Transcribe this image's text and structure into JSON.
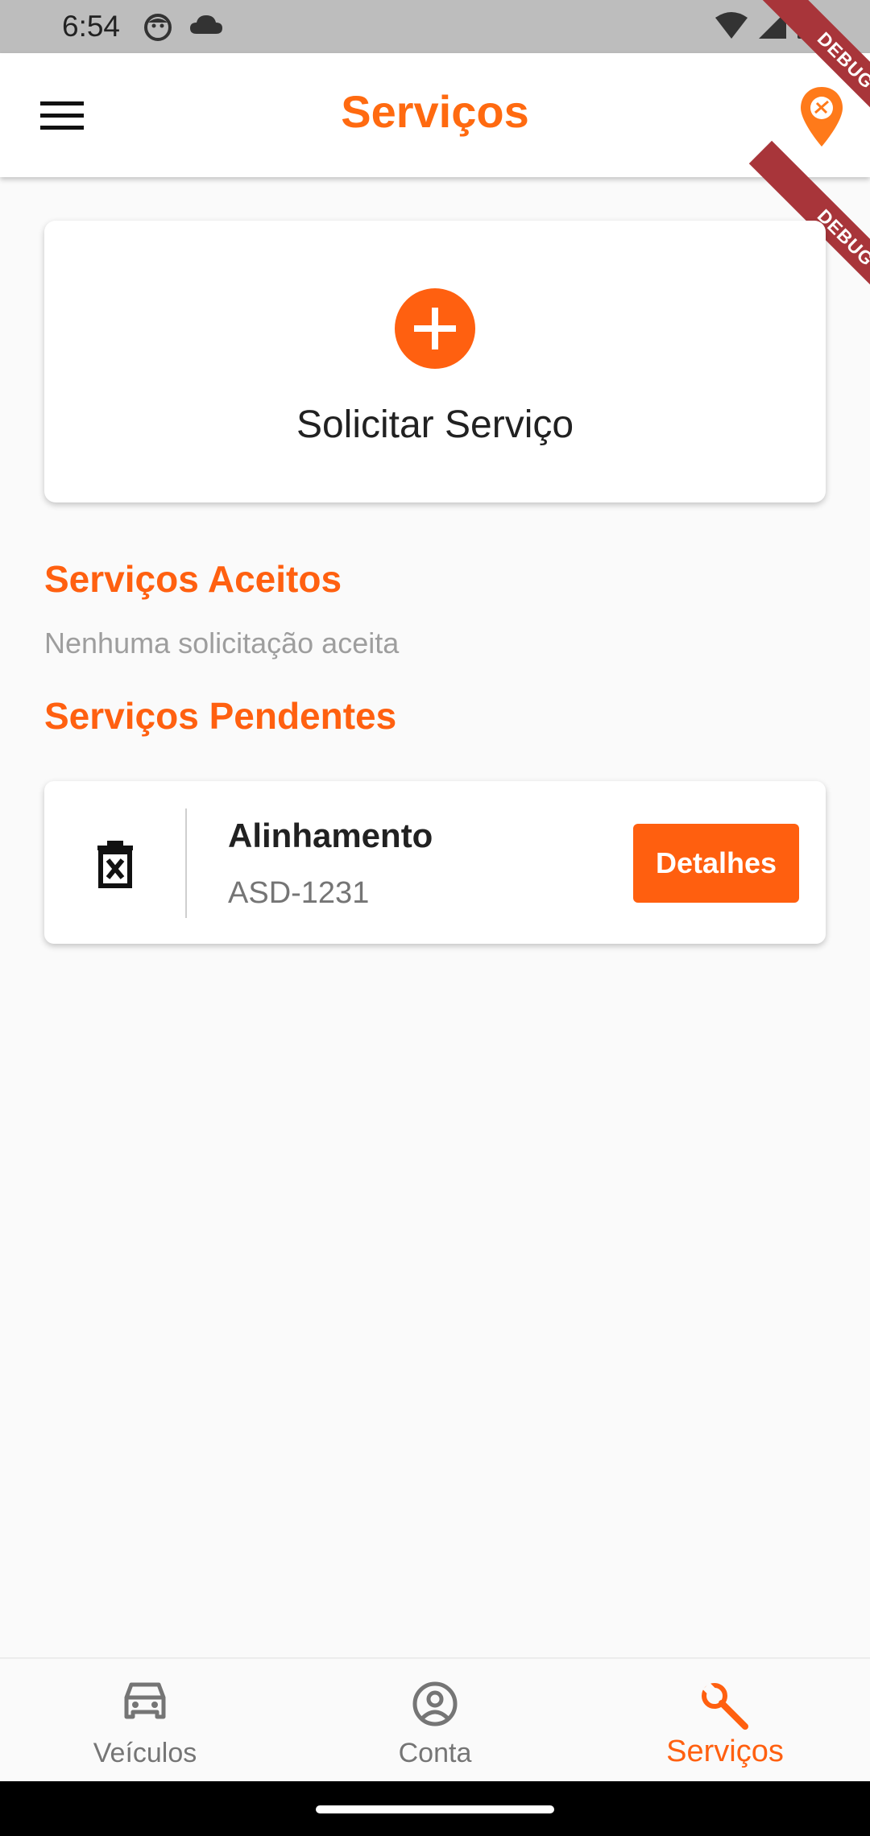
{
  "status_bar": {
    "time": "6:54"
  },
  "app_bar": {
    "title": "Serviços"
  },
  "debug_banner": {
    "label": "DEBUG"
  },
  "request_card": {
    "label": "Solicitar Serviço"
  },
  "accepted_section": {
    "title": "Serviços Aceitos",
    "empty_message": "Nenhuma solicitação aceita"
  },
  "pending_section": {
    "title": "Serviços Pendentes",
    "items": [
      {
        "name": "Alinhamento",
        "plate": "ASD-1231",
        "details_label": "Detalhes"
      }
    ]
  },
  "bottom_nav": {
    "items": [
      {
        "label": "Veículos",
        "icon": "car-icon",
        "active": false
      },
      {
        "label": "Conta",
        "icon": "account-circle-icon",
        "active": false
      },
      {
        "label": "Serviços",
        "icon": "wrench-icon",
        "active": true
      }
    ]
  },
  "colors": {
    "accent": "#ff6010",
    "debug_ribbon": "#a8353a"
  }
}
